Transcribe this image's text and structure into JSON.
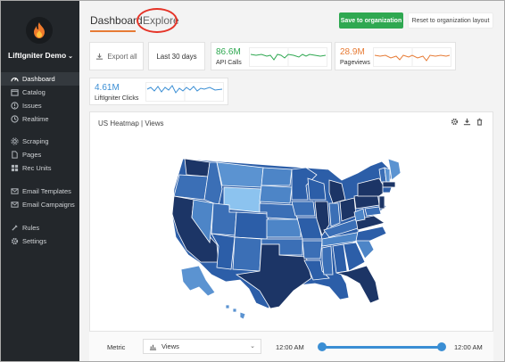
{
  "sidebar": {
    "brand": "LiftIgniter Demo",
    "items": [
      {
        "label": "Dashboard",
        "icon": "dashboard-icon",
        "active": true
      },
      {
        "label": "Catalog",
        "icon": "catalog-icon"
      },
      {
        "label": "Issues",
        "icon": "issues-icon"
      },
      {
        "label": "Realtime",
        "icon": "realtime-icon"
      },
      {
        "label": "Scraping",
        "icon": "scraping-icon"
      },
      {
        "label": "Pages",
        "icon": "pages-icon"
      },
      {
        "label": "Rec Units",
        "icon": "rec-units-icon"
      },
      {
        "label": "Email Templates",
        "icon": "email-templates-icon"
      },
      {
        "label": "Email Campaigns",
        "icon": "email-campaigns-icon"
      },
      {
        "label": "Rules",
        "icon": "rules-icon"
      },
      {
        "label": "Settings",
        "icon": "settings-icon"
      }
    ]
  },
  "tabs": {
    "dashboard": "Dashboard",
    "explore": "Explore"
  },
  "toolbar": {
    "save": "Save to organization",
    "reset": "Reset to organization layout"
  },
  "actions": {
    "export": "Export all",
    "range": "Last 30 days"
  },
  "metrics": {
    "api": {
      "value": "86.6M",
      "label": "API Calls",
      "color": "#2fa851"
    },
    "pageviews": {
      "value": "28.9M",
      "label": "Pageviews",
      "color": "#e77b35"
    },
    "clicks": {
      "value": "4.61M",
      "label": "LiftIgniter Clicks",
      "color": "#3a8ed4"
    }
  },
  "map": {
    "title": "US Heatmap | Views"
  },
  "controls": {
    "metric_label": "Metric",
    "metric_value": "Views",
    "time_start": "12:00 AM",
    "time_end": "12:00 AM"
  },
  "colors": {
    "sidebar": "#23272b",
    "accent": "#e77b35",
    "save": "#2fa851",
    "map_dark": "#1c3566",
    "map_mid": "#3b6fb6",
    "map_light": "#8cc3ef"
  }
}
